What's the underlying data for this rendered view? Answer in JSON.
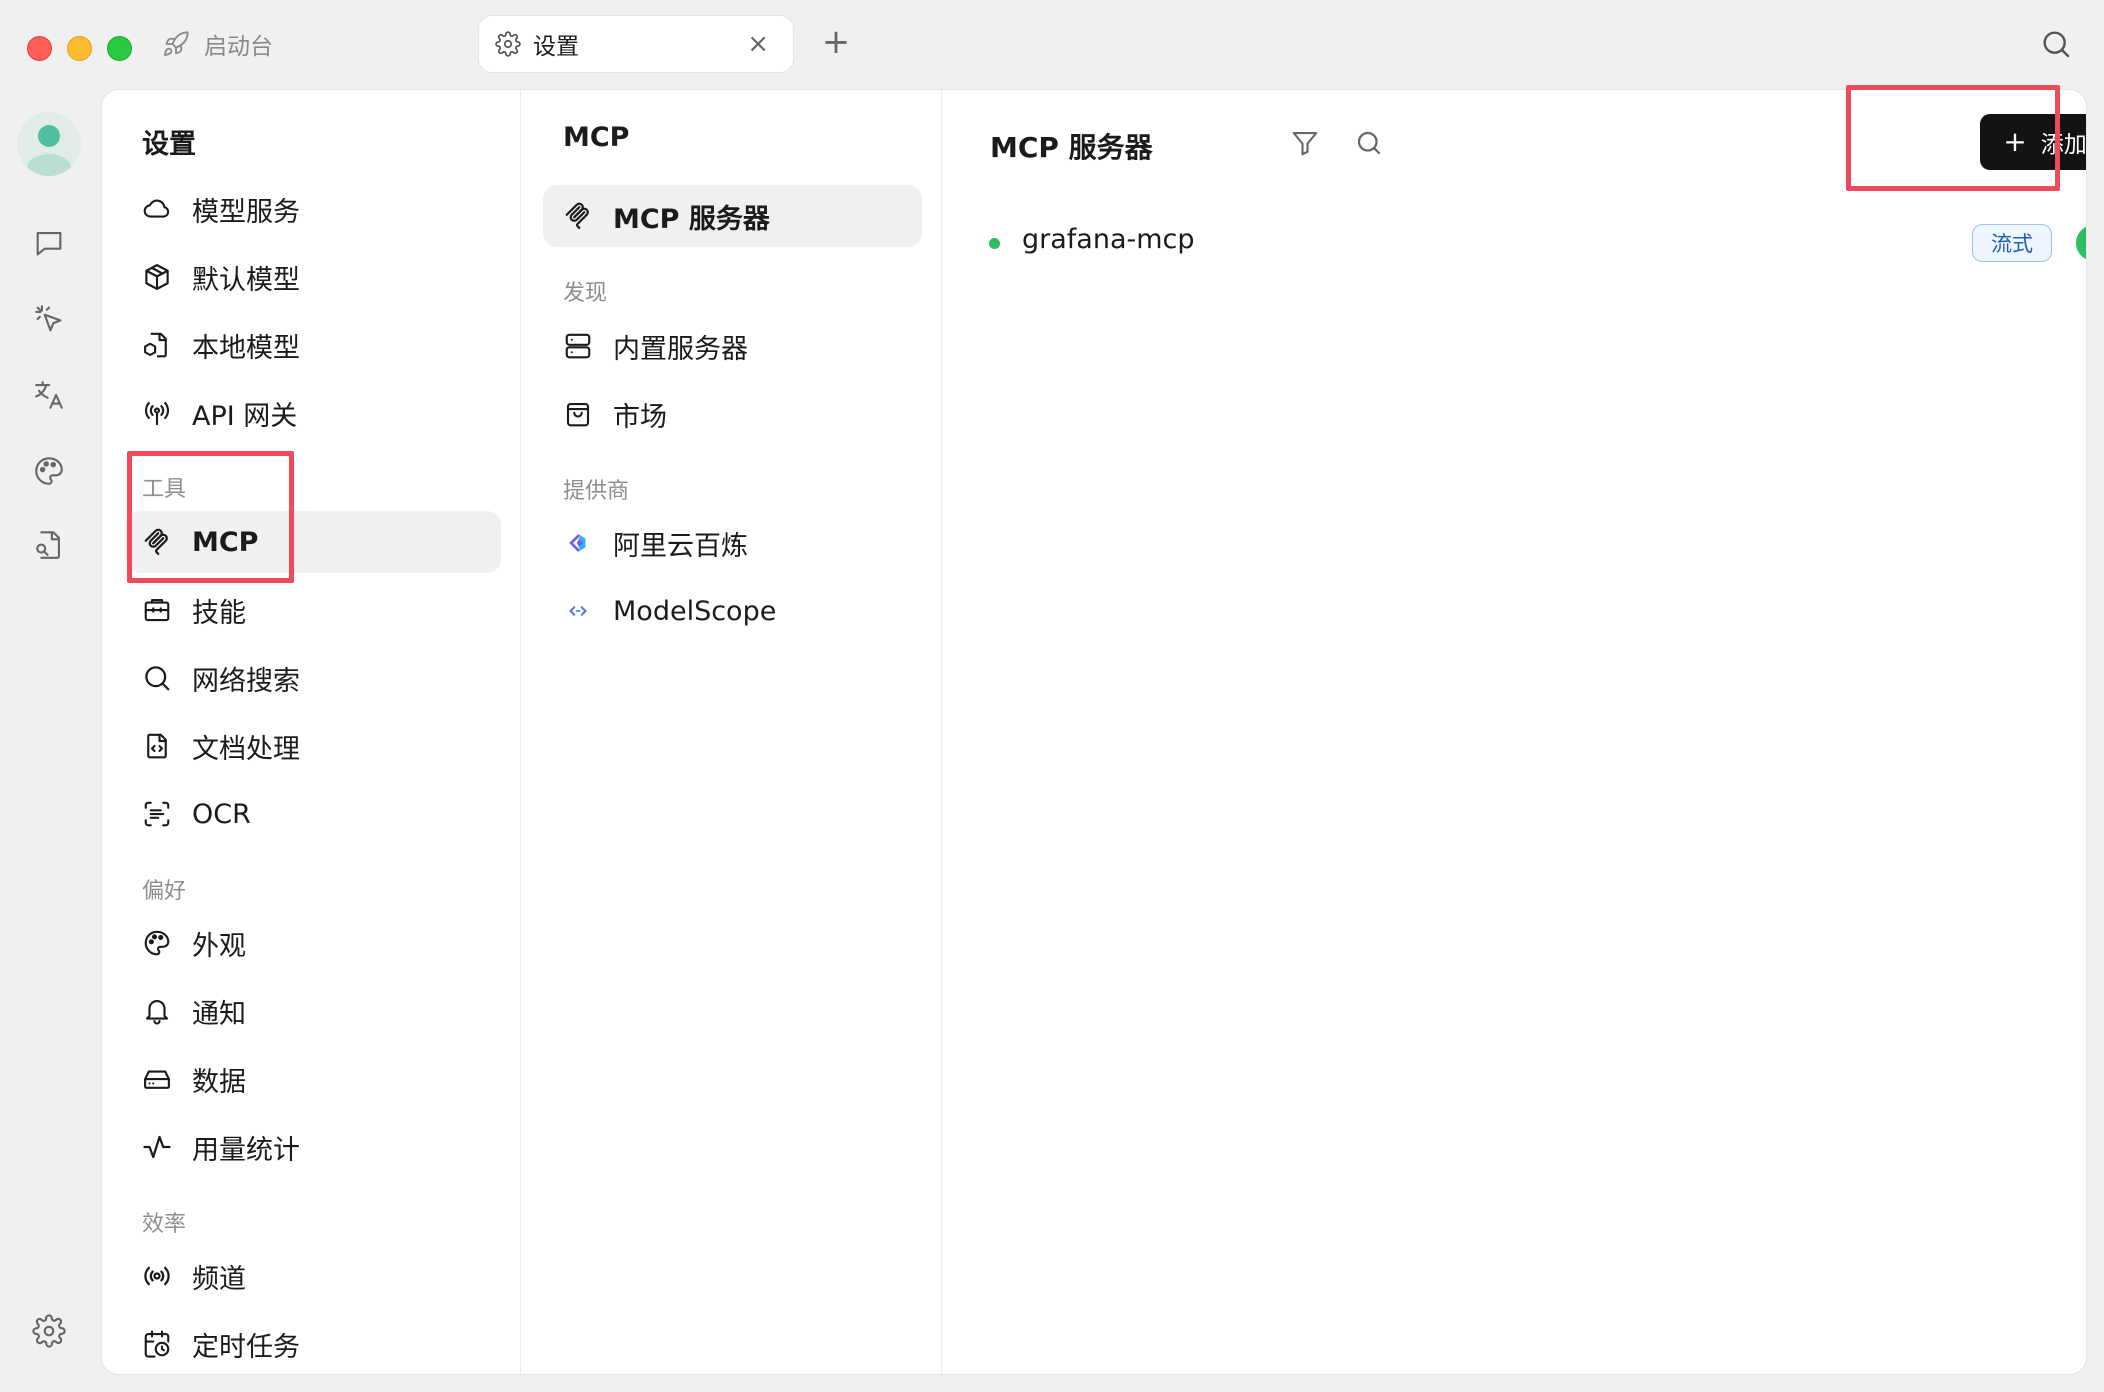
{
  "titlebar": {
    "launch_tab_label": "启动台",
    "active_tab_label": "设置",
    "close_glyph": "×",
    "new_tab_glyph": "+"
  },
  "settings": {
    "title": "设置",
    "items_top": [
      {
        "label": "模型服务",
        "icon": "cloud-icon"
      },
      {
        "label": "默认模型",
        "icon": "cube-icon"
      },
      {
        "label": "本地模型",
        "icon": "local-model-icon"
      },
      {
        "label": "API 网关",
        "icon": "antenna-icon"
      }
    ],
    "section_tools": "工具",
    "items_tools": [
      {
        "label": "MCP",
        "icon": "mcp-icon"
      },
      {
        "label": "技能",
        "icon": "toolbox-icon"
      },
      {
        "label": "网络搜索",
        "icon": "search-icon"
      },
      {
        "label": "文档处理",
        "icon": "document-code-icon"
      },
      {
        "label": "OCR",
        "icon": "scan-text-icon"
      }
    ],
    "section_prefs": "偏好",
    "items_prefs": [
      {
        "label": "外观",
        "icon": "palette-icon"
      },
      {
        "label": "通知",
        "icon": "bell-icon"
      },
      {
        "label": "数据",
        "icon": "drive-icon"
      },
      {
        "label": "用量统计",
        "icon": "activity-icon"
      }
    ],
    "section_efficiency": "效率",
    "items_efficiency": [
      {
        "label": "频道",
        "icon": "radio-icon"
      },
      {
        "label": "定时任务",
        "icon": "calendar-clock-icon"
      }
    ]
  },
  "mcp_nav": {
    "title": "MCP",
    "servers_label": "MCP 服务器",
    "section_discover": "发现",
    "discover_items": [
      {
        "label": "内置服务器",
        "icon": "server-icon"
      },
      {
        "label": "市场",
        "icon": "shopping-bag-icon"
      }
    ],
    "section_providers": "提供商",
    "provider_items": [
      {
        "label": "阿里云百炼",
        "icon": "bailian-logo-icon"
      },
      {
        "label": "ModelScope",
        "icon": "modelscope-logo-icon"
      }
    ]
  },
  "main": {
    "title": "MCP 服务器",
    "add_button_label": "添加",
    "servers": [
      {
        "name": "grafana-mcp",
        "status_color": "#2dbe5f",
        "badge": "流式",
        "enabled": true
      }
    ]
  },
  "colors": {
    "accent_green": "#2dbe5f",
    "highlight_red": "#ef4a5a",
    "badge_blue": "#1f5fa8"
  }
}
